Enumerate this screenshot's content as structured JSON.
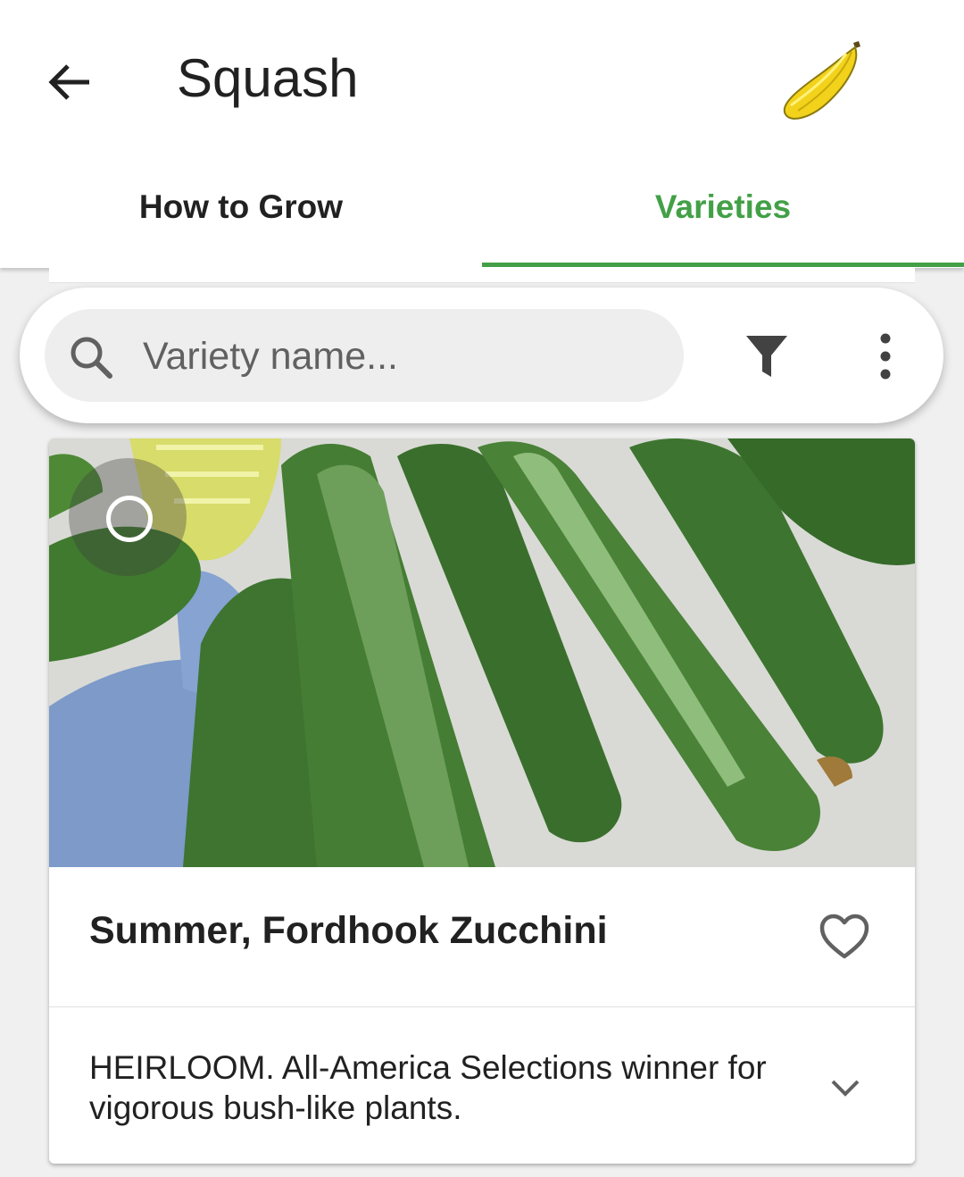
{
  "appbar": {
    "title": "Squash",
    "back_icon": "arrow-left-icon",
    "vegetable_icon": "yellow-squash-icon"
  },
  "tabs": [
    {
      "label": "How to Grow",
      "active": false
    },
    {
      "label": "Varieties",
      "active": true
    }
  ],
  "search": {
    "placeholder": "Variety name...",
    "value": "",
    "filter_icon": "filter-icon",
    "more_icon": "more-vert-icon"
  },
  "variety_card": {
    "name": "Summer, Fordhook Zucchini",
    "description": "HEIRLOOM. All-America Selections winner for vigorous bush-like plants.",
    "favorite_icon": "heart-outline-icon",
    "expand_icon": "chevron-down-icon",
    "select_icon": "circle-outline-icon"
  },
  "colors": {
    "accent": "#43a047",
    "text_primary": "#212121",
    "background": "#f0f0f0"
  }
}
